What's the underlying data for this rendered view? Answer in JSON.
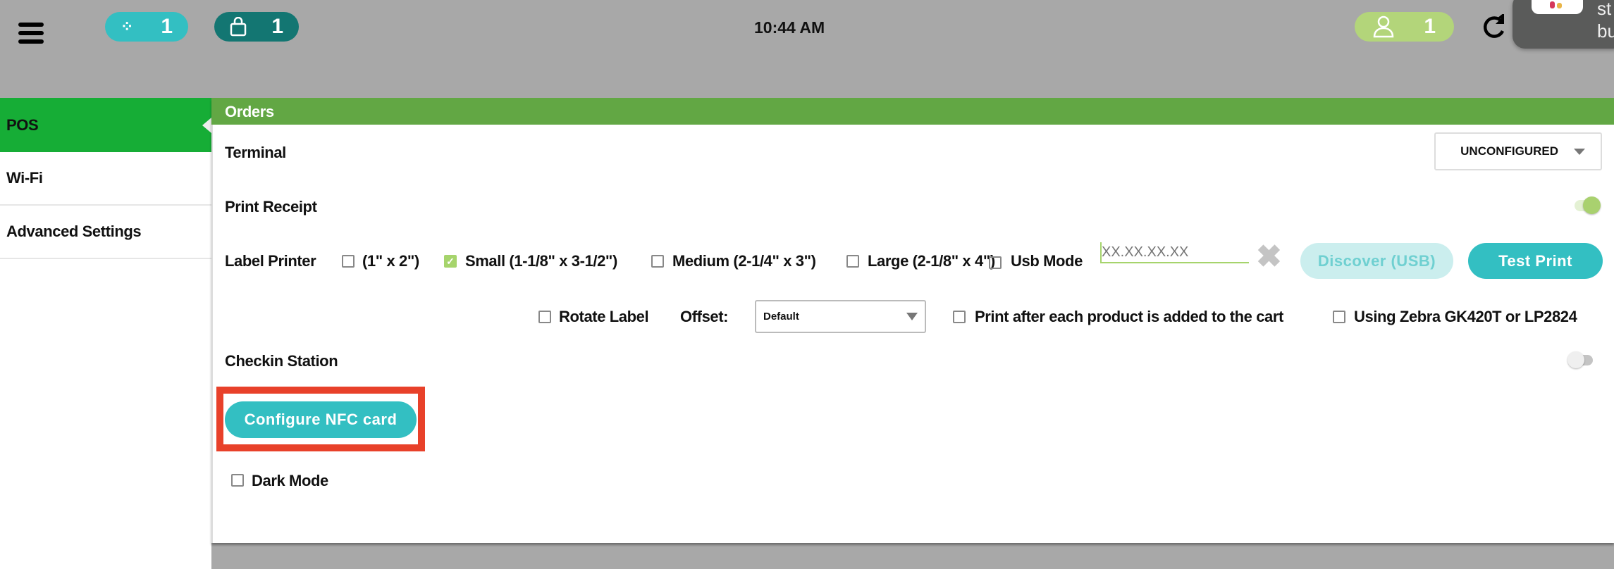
{
  "header": {
    "time": "10:44 AM",
    "badges": [
      {
        "icon": "spinner-icon",
        "count": "1",
        "color": "#33bfc2"
      },
      {
        "icon": "shopping-bag-icon",
        "count": "1",
        "color": "#137672"
      },
      {
        "icon": "user-icon",
        "count": "1",
        "color": "#b3d57a"
      }
    ],
    "refresh_icon": "refresh-icon",
    "notification": {
      "line1": "st",
      "line2": "bu"
    }
  },
  "sidebar": {
    "items": [
      {
        "label": "POS",
        "active": true
      },
      {
        "label": "Wi-Fi"
      },
      {
        "label": "Advanced Settings"
      }
    ]
  },
  "section": {
    "title": "Orders"
  },
  "terminal": {
    "label": "Terminal",
    "value": "UNCONFIGURED"
  },
  "print_receipt": {
    "label": "Print Receipt",
    "on": true
  },
  "label_printer": {
    "label": "Label Printer",
    "options": [
      {
        "label": "(1\" x 2\")",
        "checked": false
      },
      {
        "label": "Small (1-1/8\" x 3-1/2\")",
        "checked": true
      },
      {
        "label": "Medium (2-1/4\" x 3\")",
        "checked": false
      },
      {
        "label": "Large (2-1/8\" x 4\")",
        "checked": false
      }
    ],
    "usb_mode": {
      "label": "Usb Mode",
      "checked": false
    },
    "ip_placeholder": "XX.XX.XX.XX",
    "discover_label": "Discover (USB)",
    "test_print_label": "Test Print"
  },
  "label_options": {
    "rotate_label": "Rotate Label",
    "offset_label": "Offset:",
    "offset_value": "Default",
    "print_after": "Print after each product is added to the cart",
    "zebra": "Using Zebra GK420T or LP2824"
  },
  "checkin": {
    "label": "Checkin Station",
    "on": false
  },
  "nfc": {
    "label": "Configure NFC card"
  },
  "dark_mode": {
    "label": "Dark Mode",
    "checked": false
  },
  "colors": {
    "accent": "#33bfc2",
    "section_green": "#62a744",
    "sidebar_active": "#16ad36",
    "highlight": "#e8412a"
  }
}
